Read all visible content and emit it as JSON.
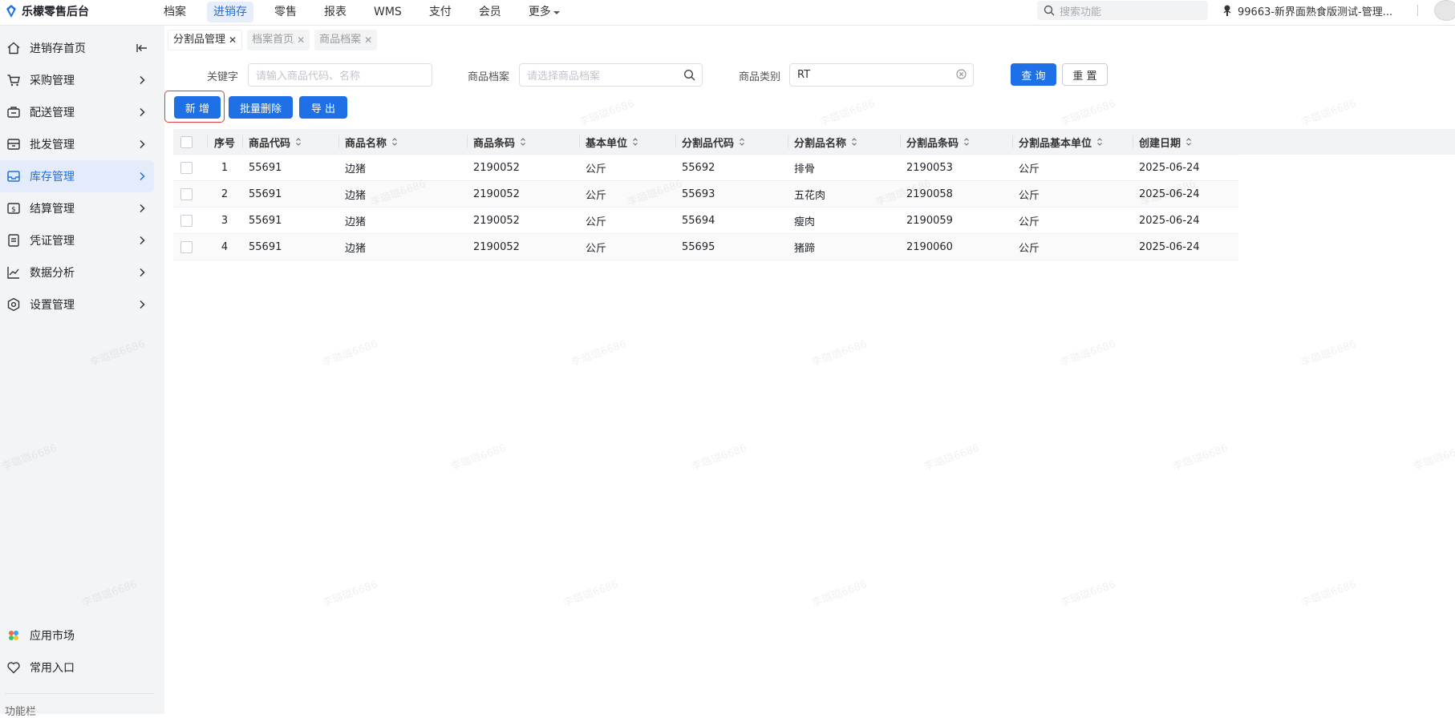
{
  "app": {
    "title": "乐檬零售后台"
  },
  "topnav": {
    "items": [
      "档案",
      "进销存",
      "零售",
      "报表",
      "WMS",
      "支付",
      "会员"
    ],
    "active_index": 1,
    "more_label": "更多",
    "search_placeholder": "搜索功能",
    "user_label": "99663-新界面熟食版测试-管理..."
  },
  "sidebar": {
    "items": [
      {
        "label": "进销存首页",
        "icon": "home-icon"
      },
      {
        "label": "采购管理",
        "icon": "cart-icon"
      },
      {
        "label": "配送管理",
        "icon": "delivery-icon"
      },
      {
        "label": "批发管理",
        "icon": "wholesale-icon"
      },
      {
        "label": "库存管理",
        "icon": "inventory-icon",
        "active": true
      },
      {
        "label": "结算管理",
        "icon": "settlement-icon"
      },
      {
        "label": "凭证管理",
        "icon": "voucher-icon"
      },
      {
        "label": "数据分析",
        "icon": "chart-icon"
      },
      {
        "label": "设置管理",
        "icon": "settings-icon"
      }
    ],
    "bottom_items": [
      {
        "label": "应用市场",
        "icon": "app-market-icon"
      },
      {
        "label": "常用入口",
        "icon": "heart-icon"
      }
    ],
    "footer_label": "功能栏"
  },
  "tabs": [
    {
      "label": "分割品管理",
      "active": true
    },
    {
      "label": "档案首页",
      "active": false
    },
    {
      "label": "商品档案",
      "active": false
    }
  ],
  "filters": {
    "keyword_label": "关键字",
    "keyword_placeholder": "请输入商品代码、名称",
    "archive_label": "商品档案",
    "archive_placeholder": "请选择商品档案",
    "category_label": "商品类别",
    "category_value": "RT",
    "query_button": "查 询",
    "reset_button": "重 置"
  },
  "actions": {
    "add_button": "新 增",
    "batch_delete_button": "批量删除",
    "export_button": "导 出"
  },
  "table": {
    "columns": [
      "序号",
      "商品代码",
      "商品名称",
      "商品条码",
      "基本单位",
      "分割品代码",
      "分割品名称",
      "分割品条码",
      "分割品基本单位",
      "创建日期"
    ],
    "rows": [
      [
        "1",
        "55691",
        "边猪",
        "2190052",
        "公斤",
        "55692",
        "排骨",
        "2190053",
        "公斤",
        "2025-06-24"
      ],
      [
        "2",
        "55691",
        "边猪",
        "2190052",
        "公斤",
        "55693",
        "五花肉",
        "2190058",
        "公斤",
        "2025-06-24"
      ],
      [
        "3",
        "55691",
        "边猪",
        "2190052",
        "公斤",
        "55694",
        "瘦肉",
        "2190059",
        "公斤",
        "2025-06-24"
      ],
      [
        "4",
        "55691",
        "边猪",
        "2190052",
        "公斤",
        "55695",
        "猪蹄",
        "2190060",
        "公斤",
        "2025-06-24"
      ]
    ]
  },
  "watermark_text": "李璐璐6686",
  "colors": {
    "primary": "#1f6fe6",
    "highlight": "#e23a3a",
    "sidebar_bg": "#f3f4f6"
  }
}
